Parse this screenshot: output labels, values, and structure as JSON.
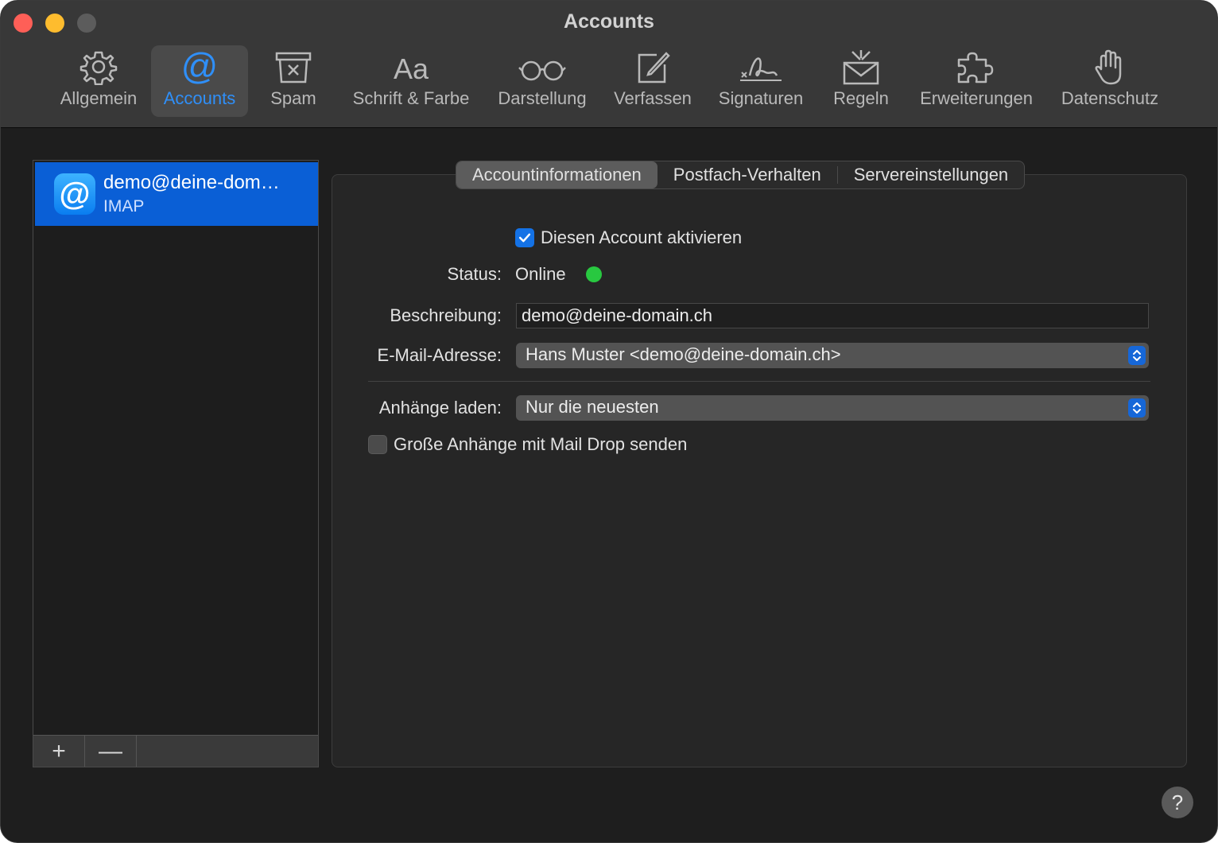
{
  "window": {
    "title": "Accounts"
  },
  "toolbar": {
    "items": [
      {
        "label": "Allgemein",
        "icon": "gear-icon"
      },
      {
        "label": "Accounts",
        "icon": "at-icon",
        "selected": true
      },
      {
        "label": "Spam",
        "icon": "junk-icon"
      },
      {
        "label": "Schrift & Farbe",
        "icon": "font-icon"
      },
      {
        "label": "Darstellung",
        "icon": "glasses-icon"
      },
      {
        "label": "Verfassen",
        "icon": "compose-icon"
      },
      {
        "label": "Signaturen",
        "icon": "signature-icon"
      },
      {
        "label": "Regeln",
        "icon": "rules-icon"
      },
      {
        "label": "Erweiterungen",
        "icon": "puzzle-icon"
      },
      {
        "label": "Datenschutz",
        "icon": "hand-icon"
      }
    ]
  },
  "accounts": [
    {
      "name": "demo@deine-dom…",
      "type": "IMAP",
      "icon_glyph": "@",
      "selected": true
    }
  ],
  "sidebar_footer": {
    "add": "+",
    "remove": "—"
  },
  "tabs": [
    {
      "label": "Accountinformationen",
      "active": true
    },
    {
      "label": "Postfach-Verhalten"
    },
    {
      "label": "Servereinstellungen"
    }
  ],
  "form": {
    "enable_account": {
      "label": "Diesen Account aktivieren",
      "checked": true
    },
    "status": {
      "label": "Status:",
      "value": "Online",
      "color": "#28c840"
    },
    "description": {
      "label": "Beschreibung:",
      "value": "demo@deine-domain.ch"
    },
    "email": {
      "label": "E-Mail-Adresse:",
      "value": "Hans Muster <demo@deine-domain.ch>"
    },
    "attachments": {
      "label": "Anhänge laden:",
      "value": "Nur die neuesten"
    },
    "mail_drop": {
      "label": "Große Anhänge mit Mail Drop senden",
      "checked": false
    }
  },
  "help": {
    "glyph": "?"
  },
  "colors": {
    "accent": "#2f8ff8",
    "selection": "#0a5fd6"
  }
}
